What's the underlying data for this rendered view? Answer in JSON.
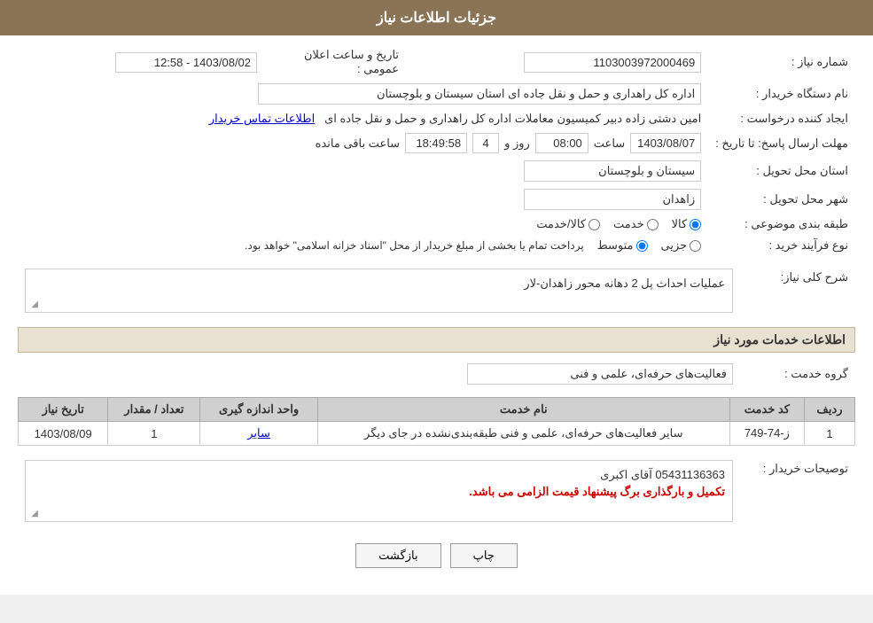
{
  "page": {
    "header_title": "جزئیات اطلاعات نیاز"
  },
  "fields": {
    "request_number_label": "شماره نیاز :",
    "request_number_value": "1103003972000469",
    "buyer_org_label": "نام دستگاه خریدار :",
    "buyer_org_value": "اداره کل راهداری و حمل و نقل جاده ای استان سیستان و بلوچستان",
    "creator_label": "ایجاد کننده درخواست :",
    "creator_value": "امین دشتی زاده دبیر کمیسیون معاملات اداره کل راهداری و حمل و نقل جاده ای",
    "creator_link": "اطلاعات تماس خریدار",
    "deadline_label": "مهلت ارسال پاسخ: تا تاریخ :",
    "deadline_date": "1403/08/07",
    "deadline_time_label": "ساعت",
    "deadline_time": "08:00",
    "deadline_days_label": "روز و",
    "deadline_days": "4",
    "deadline_remaining_label": "ساعت باقی مانده",
    "deadline_remaining": "18:49:58",
    "announce_label": "تاریخ و ساعت اعلان عمومی :",
    "announce_value": "1403/08/02 - 12:58",
    "province_label": "استان محل تحویل :",
    "province_value": "سیستان و بلوچستان",
    "city_label": "شهر محل تحویل :",
    "city_value": "زاهدان",
    "category_label": "طبقه بندی موضوعی :",
    "category_options": [
      "کالا",
      "خدمت",
      "کالا/خدمت"
    ],
    "category_selected": "کالا",
    "purchase_type_label": "نوع فرآیند خرید :",
    "purchase_type_options": [
      "جزیی",
      "متوسط"
    ],
    "purchase_type_desc": "پرداخت تمام یا بخشی از مبلغ خریدار از محل \"اسناد خزانه اسلامی\" خواهد بود.",
    "description_section_title": "شرح کلی نیاز:",
    "description_value": "عملیات احداث پل 2 دهانه محور زاهدان-لار",
    "services_section_title": "اطلاعات خدمات مورد نیاز",
    "service_group_label": "گروه خدمت :",
    "service_group_value": "فعالیت‌های حرفه‌ای، علمی و فنی",
    "table_headers": [
      "ردیف",
      "کد خدمت",
      "نام خدمت",
      "واحد اندازه گیری",
      "تعداد / مقدار",
      "تاریخ نیاز"
    ],
    "table_rows": [
      {
        "row": "1",
        "code": "ز-74-749",
        "service_name": "سایر فعالیت‌های حرفه‌ای، علمی و فنی طبقه‌بندی‌نشده در جای دیگر",
        "unit": "سایر",
        "quantity": "1",
        "date": "1403/08/09",
        "unit_link": true
      }
    ],
    "buyer_notes_label": "توصیحات خریدار :",
    "buyer_notes_line1": "05431136363 آقای اکبری",
    "buyer_notes_line2": "تکمیل و بارگذاری برگ پیشنهاد قیمت الزامی می باشد.",
    "btn_print": "چاپ",
    "btn_back": "بازگشت"
  }
}
